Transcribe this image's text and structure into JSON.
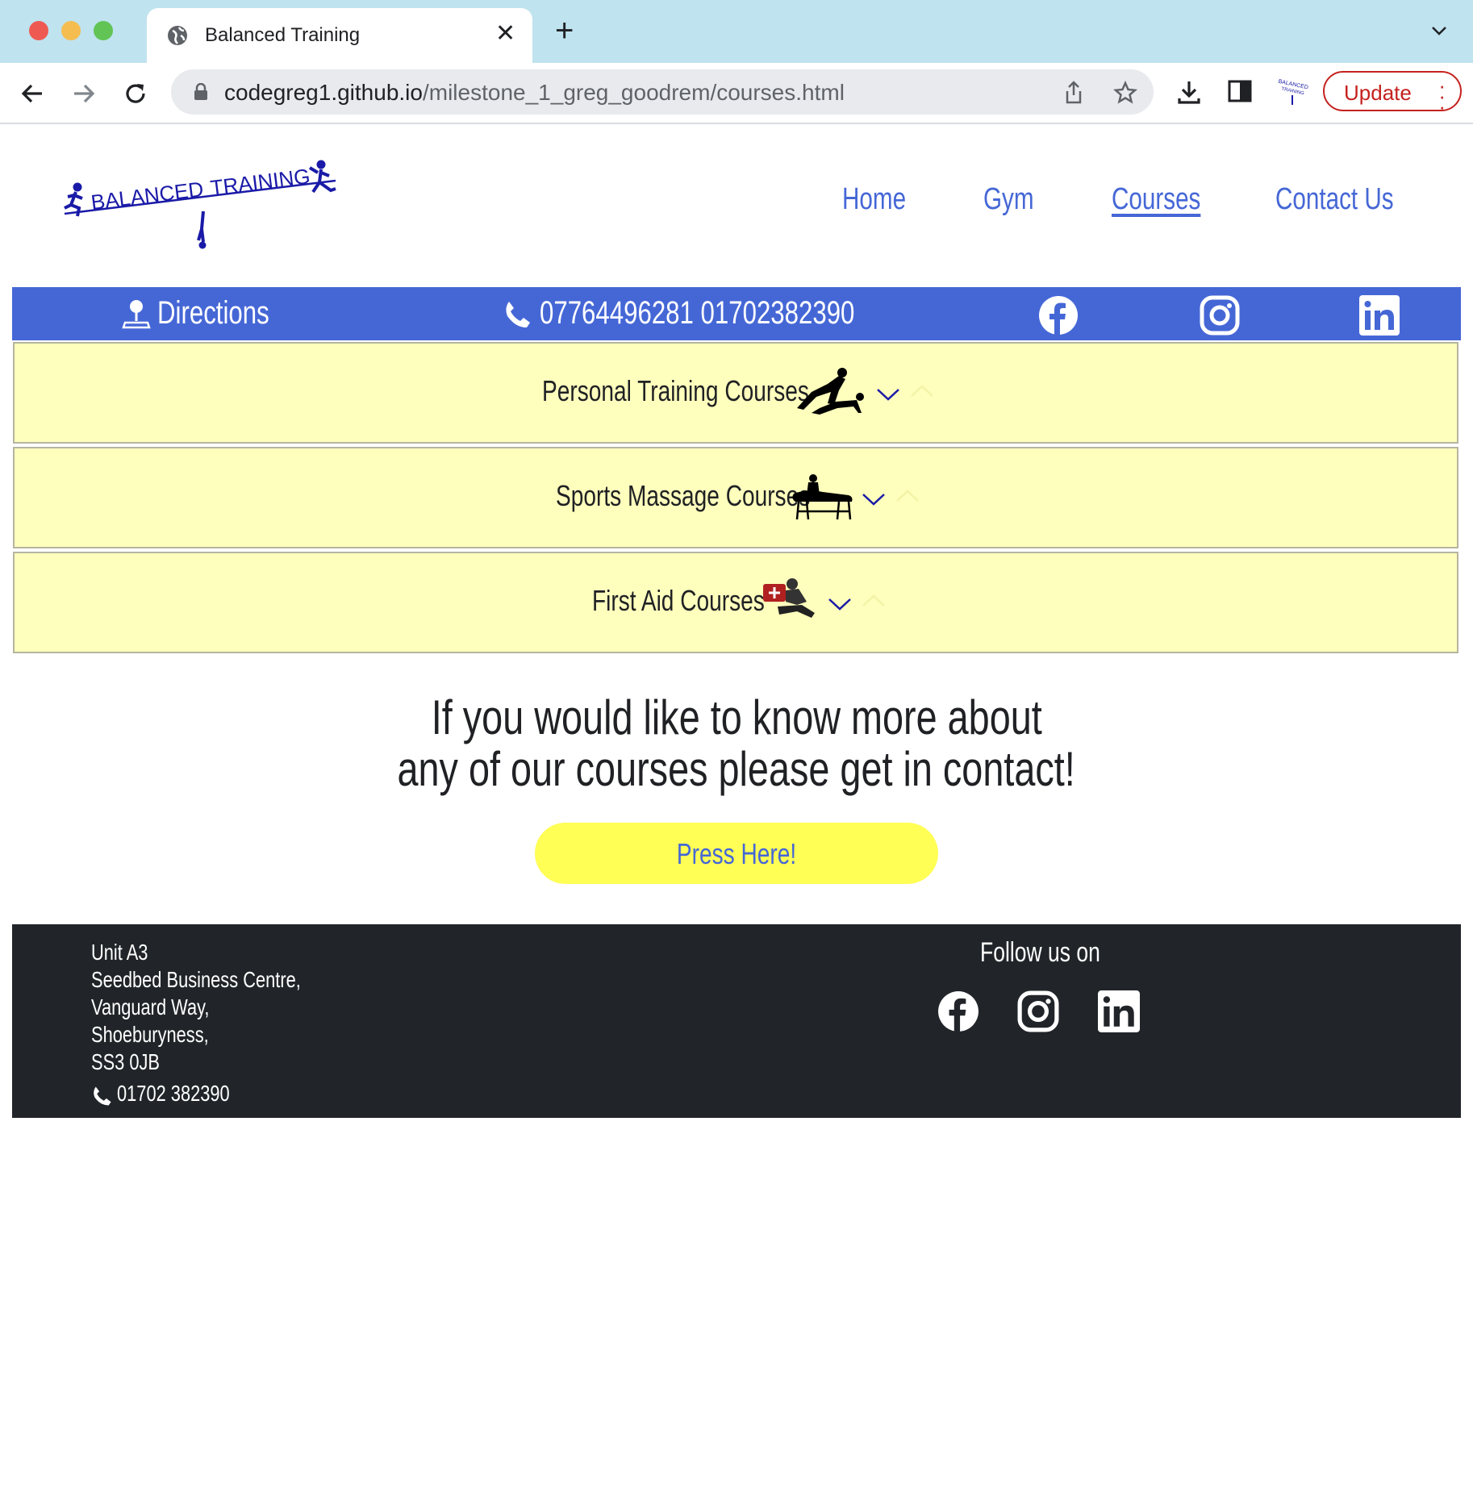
{
  "browser": {
    "tab_title": "Balanced Training",
    "url_host": "codegreg1.github.io",
    "url_path": "/milestone_1_greg_goodrem/courses.html",
    "update_label": "Update"
  },
  "header": {
    "logo_text_left": "BALANCED",
    "logo_text_right": "TRAINING",
    "nav": [
      {
        "label": "Home"
      },
      {
        "label": "Gym"
      },
      {
        "label": "Courses"
      },
      {
        "label": "Contact Us"
      }
    ]
  },
  "contact_bar": {
    "directions_label": "Directions",
    "phone_numbers": "07764496281 01702382390"
  },
  "accordions": [
    {
      "title": "Personal Training Courses"
    },
    {
      "title": "Sports Massage Courses"
    },
    {
      "title": "First Aid Courses"
    }
  ],
  "cta": {
    "line1": "If you would like to know more about",
    "line2": "any of our courses please get in contact!",
    "button_label": "Press Here!"
  },
  "footer": {
    "address_lines": [
      "Unit A3",
      "Seedbed Business Centre,",
      "Vanguard Way,",
      "Shoeburyness,",
      "SS3 0JB"
    ],
    "phone": "01702 382390",
    "follow_label": "Follow us on"
  },
  "colors": {
    "brand_blue": "#4567d6",
    "accordion_bg": "#ffffbd",
    "button_yellow": "#ffff55",
    "footer_bg": "#212529"
  },
  "icons": [
    "globe-icon",
    "close-icon",
    "plus-icon",
    "back-icon",
    "forward-icon",
    "reload-icon",
    "lock-icon",
    "share-icon",
    "star-icon",
    "download-icon",
    "sidepanel-icon",
    "location-icon",
    "phone-icon",
    "facebook-icon",
    "instagram-icon",
    "linkedin-icon",
    "chevron-down-icon",
    "chevron-up-icon"
  ]
}
